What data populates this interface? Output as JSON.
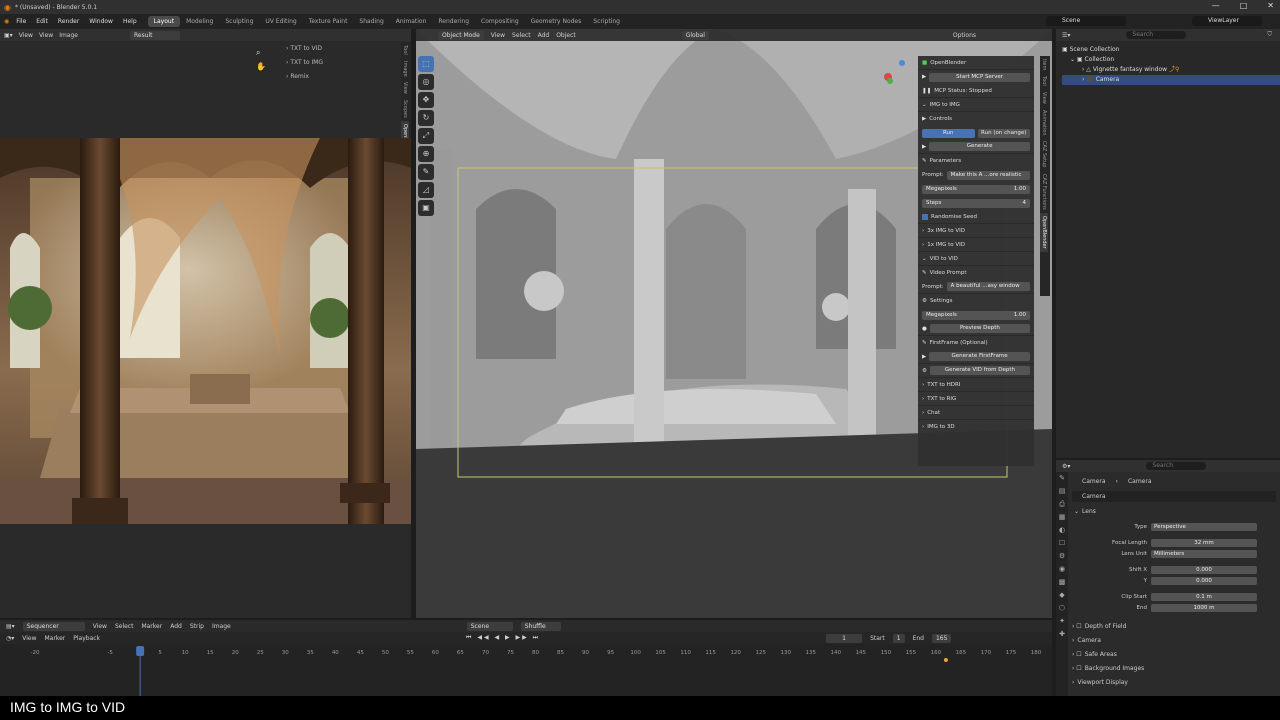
{
  "title": "* (Unsaved) - Blender 5.0.1",
  "window_controls": [
    "—",
    "□",
    "✕"
  ],
  "menu": [
    "File",
    "Edit",
    "Render",
    "Window",
    "Help"
  ],
  "workspaces": [
    "Layout",
    "Modeling",
    "Sculpting",
    "UV Editing",
    "Texture Paint",
    "Shading",
    "Animation",
    "Rendering",
    "Compositing",
    "Geometry Nodes",
    "Scripting"
  ],
  "scene": "Scene",
  "view_layer": "ViewLayer",
  "image_editor": {
    "menu": [
      "View",
      "View",
      "Image"
    ],
    "image_name": "Result",
    "side_items": [
      "TXT to VID",
      "TXT to IMG",
      "Remix"
    ],
    "tabs": [
      "Tool",
      "Image",
      "View",
      "Scopes",
      "OpenBlender"
    ]
  },
  "viewport": {
    "mode": "Object Mode",
    "menu": [
      "View",
      "Select",
      "Add",
      "Object"
    ],
    "orientation": "Global",
    "options": "Options",
    "tabs": [
      "Item",
      "Tool",
      "View",
      "Animation",
      "CAZ Setup",
      "CAZ Functions",
      "OpenBlender"
    ],
    "panel": {
      "title": "OpenBlender",
      "start_mcp": "Start MCP Server",
      "mcp_status": "MCP Status: Stopped",
      "img_to_img": "IMG to IMG",
      "controls": "Controls",
      "run": "Run",
      "run_on_change": "Run (on change)",
      "generate": "Generate",
      "parameters": "Parameters",
      "prompt_label": "Prompt:",
      "prompt_value": "Make this A ...ore realistic",
      "megapixels_label": "Megapixels",
      "megapixels_value": "1.00",
      "steps_label": "Steps",
      "steps_value": "4",
      "randomise_seed": "Randomise Seed",
      "img_to_vid_3x": "3x IMG to VID",
      "img_to_vid_1x": "1x IMG to VID",
      "vid_to_vid": "VID to VID",
      "video_prompt": "Video Prompt",
      "vid_prompt_label": "Prompt:",
      "vid_prompt_value": "A beautiful ...asy window",
      "settings": "Settings",
      "vid_megapixels_label": "Megapixels",
      "vid_megapixels_value": "1.00",
      "preview_depth": "Preview Depth",
      "firstframe": "FirstFrame (Optional)",
      "generate_firstframe": "Generate FirstFrame",
      "generate_vid_depth": "Generate VID from Depth",
      "txt_to_hdri": "TXT to HDRI",
      "txt_to_rig": "TXT to RIG",
      "chat": "Chat",
      "img_to_3d": "IMG to 3D"
    }
  },
  "outliner": {
    "search_placeholder": "Search",
    "scene_collection": "Scene Collection",
    "collection": "Collection",
    "object1": "Vignette fantasy window",
    "object2": "Camera"
  },
  "properties": {
    "search_placeholder": "Search",
    "breadcrumb": [
      "Camera",
      "Camera"
    ],
    "datablock": "Camera",
    "lens_section": "Lens",
    "type_label": "Type",
    "type_value": "Perspective",
    "focal_label": "Focal Length",
    "focal_value": "32 mm",
    "lens_unit_label": "Lens Unit",
    "lens_unit_value": "Millimeters",
    "shift_x_label": "Shift X",
    "shift_x_value": "0.000",
    "shift_y_label": "Y",
    "shift_y_value": "0.000",
    "clip_start_label": "Clip Start",
    "clip_start_value": "0.1 m",
    "clip_end_label": "End",
    "clip_end_value": "1000 m",
    "sections": [
      "Depth of Field",
      "Camera",
      "Safe Areas",
      "Background Images",
      "Viewport Display"
    ]
  },
  "timeline": {
    "editor": "Sequencer",
    "menu": [
      "View",
      "Select",
      "Marker",
      "Add",
      "Strip",
      "Image"
    ],
    "scene": "Scene",
    "shuffle": "Shuffle",
    "menu2": [
      "View",
      "Marker",
      "Playback"
    ],
    "current_frame": "1",
    "start_label": "Start",
    "start_value": "1",
    "end_label": "End",
    "end_value": "165",
    "ticks": [
      "-20",
      "-5",
      "1",
      "5",
      "10",
      "15",
      "20",
      "25",
      "30",
      "35",
      "40",
      "45",
      "50",
      "55",
      "60",
      "65",
      "70",
      "75",
      "80",
      "85",
      "90",
      "95",
      "100",
      "105",
      "110",
      "115",
      "120",
      "125",
      "130",
      "135",
      "140",
      "145",
      "150",
      "155",
      "160",
      "165",
      "170",
      "175",
      "180"
    ],
    "playhead_frame": 1,
    "keyframe_frame": 162
  },
  "caption": "IMG to IMG to VID",
  "colors": {
    "accent": "#4772b3",
    "active_orange": "#e8a33c",
    "camera_frame": "#c8c86a"
  }
}
